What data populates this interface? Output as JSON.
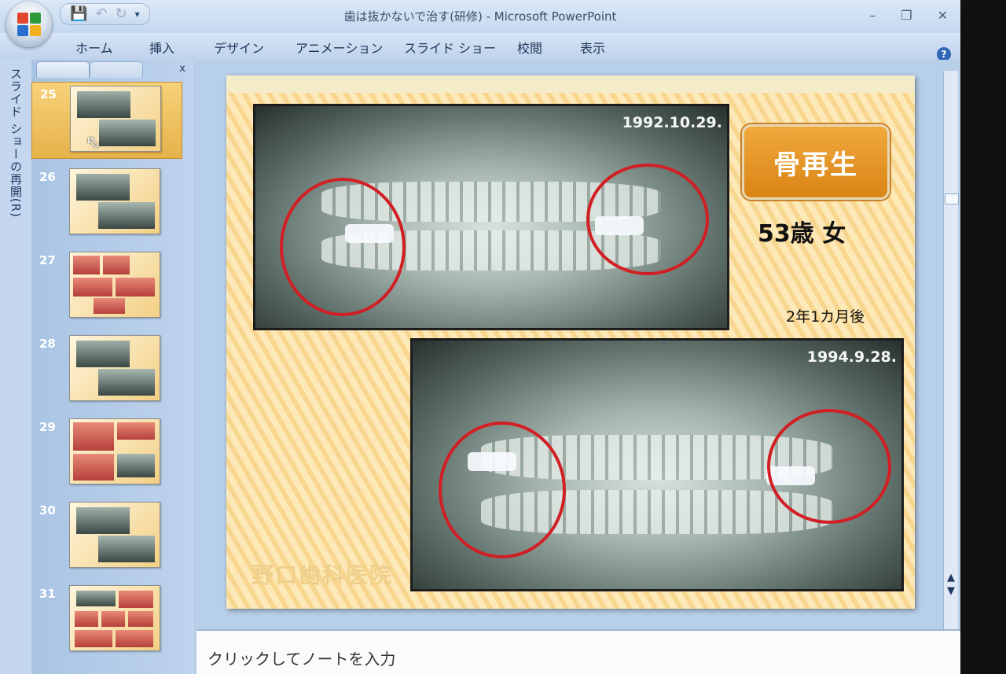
{
  "window": {
    "title": "歯は抜かないで治す(研修) - Microsoft PowerPoint",
    "minimize_icon": "minimize-icon",
    "restore_icon": "restore-icon",
    "close_icon": "close-icon"
  },
  "ribbon": {
    "tabs": [
      "ホーム",
      "挿入",
      "デザイン",
      "アニメーション",
      "スライド ショー",
      "校閲",
      "表示"
    ],
    "help_glyph": "?"
  },
  "sidebar": {
    "resume_label": "スライド ショーの再開(R)",
    "close_glyph": "x",
    "slides": [
      {
        "number": "25",
        "selected": true
      },
      {
        "number": "26"
      },
      {
        "number": "27"
      },
      {
        "number": "28"
      },
      {
        "number": "29"
      },
      {
        "number": "30"
      },
      {
        "number": "31"
      }
    ]
  },
  "slide": {
    "badge": "骨再生",
    "age": "53歳 女",
    "interval": "2年1カ月後",
    "xray_top_date": "1992.10.29.",
    "xray_bottom_date": "1994.9.28.",
    "clinic": "野口歯科医院",
    "accent_color": "#d11f24",
    "badge_color": "#e3941f"
  },
  "notes": {
    "placeholder": "クリックしてノートを入力"
  }
}
